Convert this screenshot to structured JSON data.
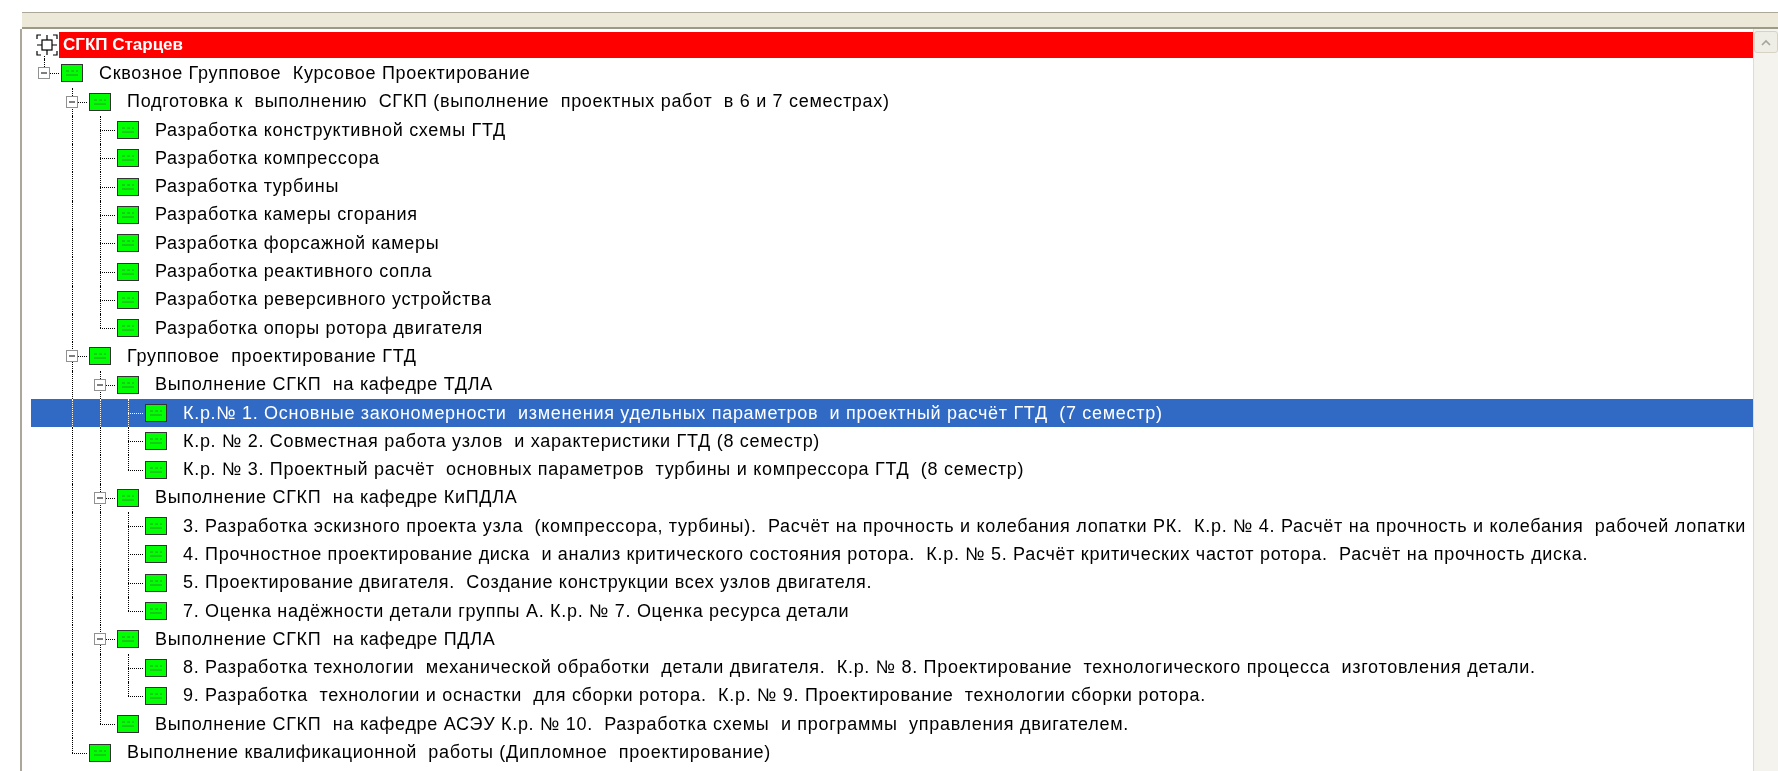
{
  "root": {
    "label": "СГКП Старцев",
    "highlighted": true,
    "children": [
      {
        "label": "Сквозное Групповое  Курсовое Проектирование",
        "expanded": true,
        "selected": false,
        "children": [
          {
            "label": "Подготовка к  выполнению  СГКП (выполнение  проектных работ  в 6 и 7 семестрах)",
            "expanded": true,
            "selected": false,
            "children": [
              {
                "label": "Разработка конструктивной схемы ГТД",
                "selected": false
              },
              {
                "label": "Разработка компрессора",
                "selected": false
              },
              {
                "label": "Разработка турбины",
                "selected": false
              },
              {
                "label": "Разработка камеры сгорания",
                "selected": false
              },
              {
                "label": "Разработка форсажной камеры",
                "selected": false
              },
              {
                "label": "Разработка реактивного сопла",
                "selected": false
              },
              {
                "label": "Разработка реверсивного устройства",
                "selected": false
              },
              {
                "label": "Разработка опоры ротора двигателя",
                "selected": false
              }
            ]
          },
          {
            "label": "Групповое  проектирование ГТД",
            "expanded": true,
            "selected": false,
            "children": [
              {
                "label": "Выполнение СГКП  на кафедре ТДЛА",
                "expanded": true,
                "selected": false,
                "children": [
                  {
                    "label": "К.р.№ 1. Основные закономерности  изменения удельных параметров  и проектный расчёт ГТД  (7 семестр)",
                    "selected": true
                  },
                  {
                    "label": "К.р. № 2. Совместная работа узлов  и характеристики ГТД (8 семестр)",
                    "selected": false
                  },
                  {
                    "label": "К.р. № 3. Проектный расчёт  основных параметров  турбины и компрессора ГТД  (8 семестр)",
                    "selected": false
                  }
                ]
              },
              {
                "label": "Выполнение СГКП  на кафедре КиПДЛА",
                "expanded": true,
                "selected": false,
                "children": [
                  {
                    "label": "3. Разработка эскизного проекта узла  (компрессора, турбины).  Расчёт на прочность и колебания лопатки РК.  К.р. № 4. Расчёт на прочность и колебания  рабочей лопатки",
                    "selected": false
                  },
                  {
                    "label": "4. Прочностное проектирование диска  и анализ критического состояния ротора.  К.р. № 5. Расчёт критических частот ротора.  Расчёт на прочность диска.",
                    "selected": false
                  },
                  {
                    "label": "5. Проектирование двигателя.  Создание конструкции всех узлов двигателя.",
                    "selected": false
                  },
                  {
                    "label": "7. Оценка надёжности детали группы А. К.р. № 7. Оценка ресурса детали",
                    "selected": false
                  }
                ]
              },
              {
                "label": "Выполнение СГКП  на кафедре ПДЛА",
                "expanded": true,
                "selected": false,
                "children": [
                  {
                    "label": "8. Разработка технологии  механической обработки  детали двигателя.  К.р. № 8. Проектирование  технологического процесса  изготовления детали.",
                    "selected": false
                  },
                  {
                    "label": "9. Разработка  технологии и оснастки  для сборки ротора.  К.р. № 9. Проектирование  технологии сборки ротора.",
                    "selected": false
                  }
                ]
              },
              {
                "label": "Выполнение СГКП  на кафедре АСЭУ К.р. № 10.  Разработка схемы  и программы  управления двигателем.",
                "selected": false
              }
            ]
          },
          {
            "label": "Выполнение квалификационной  работы (Дипломное  проектирование)",
            "selected": false
          }
        ]
      }
    ]
  }
}
